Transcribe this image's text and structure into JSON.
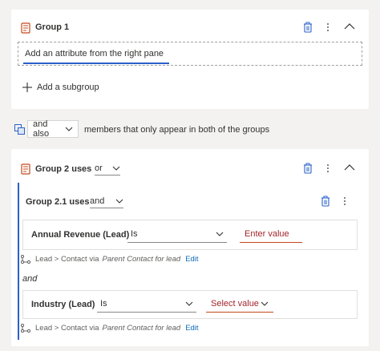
{
  "group1": {
    "title": "Group 1",
    "attribute_placeholder": "Add an attribute from the right pane",
    "add_subgroup": "Add a subgroup"
  },
  "combinator": {
    "value": "and also",
    "description": "members that only appear in both of the groups"
  },
  "group2": {
    "title": "Group 2 uses",
    "operator": "or",
    "subgroup": {
      "title": "Group 2.1 uses",
      "operator": "and",
      "conditions": [
        {
          "attribute": "Annual Revenue (Lead)",
          "operator": "Is",
          "value": "Enter value",
          "path": "Lead > Contact via",
          "path_relation": "Parent Contact for lead",
          "edit": "Edit"
        },
        {
          "attribute": "Industry (Lead)",
          "operator": "Is",
          "value": "Select value",
          "path": "Lead > Contact via",
          "path_relation": "Parent Contact for lead",
          "edit": "Edit"
        }
      ],
      "joiner": "and"
    }
  },
  "colors": {
    "accent": "#0f6cbd",
    "group_icon": "#c4481b",
    "focus_underline": "#2b61c9"
  },
  "icons": [
    "group-icon",
    "delete-icon",
    "more-icon",
    "chevron-up-icon",
    "plus-icon",
    "chevron-down-icon",
    "relationship-path-icon",
    "combine-icon"
  ]
}
